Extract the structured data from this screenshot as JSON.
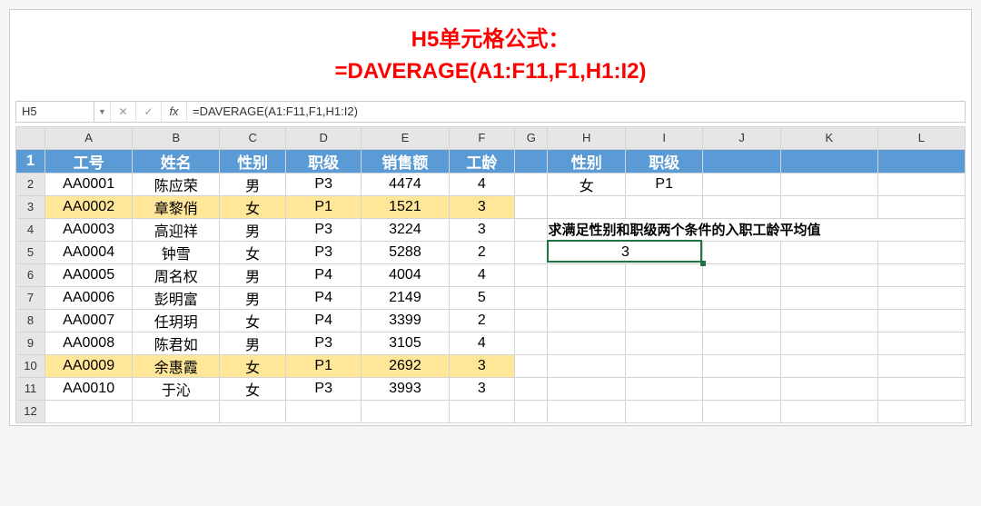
{
  "title": {
    "line1": "H5单元格公式：",
    "line2": "=DAVERAGE(A1:F11,F1,H1:I2)"
  },
  "formula_bar": {
    "cell_ref": "H5",
    "fx_label": "fx",
    "x": "✕",
    "check": "✓",
    "formula": "=DAVERAGE(A1:F11,F1,H1:I2)"
  },
  "columns": [
    "A",
    "B",
    "C",
    "D",
    "E",
    "F",
    "G",
    "H",
    "I",
    "J",
    "K",
    "L"
  ],
  "row_numbers": [
    "1",
    "2",
    "3",
    "4",
    "5",
    "6",
    "7",
    "8",
    "9",
    "10",
    "11",
    "12"
  ],
  "main_headers": [
    "工号",
    "姓名",
    "性别",
    "职级",
    "销售额",
    "工龄"
  ],
  "criteria_headers": [
    "性别",
    "职级"
  ],
  "criteria_values": [
    "女",
    "P1"
  ],
  "note": "求满足性别和职级两个条件的入职工龄平均值",
  "result": "3",
  "rows": [
    {
      "id": "AA0001",
      "name": "陈应荣",
      "gender": "男",
      "level": "P3",
      "sales": "4474",
      "years": "4",
      "hl": false
    },
    {
      "id": "AA0002",
      "name": "章黎俏",
      "gender": "女",
      "level": "P1",
      "sales": "1521",
      "years": "3",
      "hl": true
    },
    {
      "id": "AA0003",
      "name": "高迎祥",
      "gender": "男",
      "level": "P3",
      "sales": "3224",
      "years": "3",
      "hl": false
    },
    {
      "id": "AA0004",
      "name": "钟雪",
      "gender": "女",
      "level": "P3",
      "sales": "5288",
      "years": "2",
      "hl": false
    },
    {
      "id": "AA0005",
      "name": "周名权",
      "gender": "男",
      "level": "P4",
      "sales": "4004",
      "years": "4",
      "hl": false
    },
    {
      "id": "AA0006",
      "name": "彭明富",
      "gender": "男",
      "level": "P4",
      "sales": "2149",
      "years": "5",
      "hl": false
    },
    {
      "id": "AA0007",
      "name": "任玥玥",
      "gender": "女",
      "level": "P4",
      "sales": "3399",
      "years": "2",
      "hl": false
    },
    {
      "id": "AA0008",
      "name": "陈君如",
      "gender": "男",
      "level": "P3",
      "sales": "3105",
      "years": "4",
      "hl": false
    },
    {
      "id": "AA0009",
      "name": "余惠霞",
      "gender": "女",
      "level": "P1",
      "sales": "2692",
      "years": "3",
      "hl": true
    },
    {
      "id": "AA0010",
      "name": "于沁",
      "gender": "女",
      "level": "P3",
      "sales": "3993",
      "years": "3",
      "hl": false
    }
  ],
  "chart_data": {
    "type": "table",
    "title": "DAVERAGE 示例 — 求满足性别和职级两个条件的入职工龄平均值",
    "columns": [
      "工号",
      "姓名",
      "性别",
      "职级",
      "销售额",
      "工龄"
    ],
    "records": [
      [
        "AA0001",
        "陈应荣",
        "男",
        "P3",
        4474,
        4
      ],
      [
        "AA0002",
        "章黎俏",
        "女",
        "P1",
        1521,
        3
      ],
      [
        "AA0003",
        "高迎祥",
        "男",
        "P3",
        3224,
        3
      ],
      [
        "AA0004",
        "钟雪",
        "女",
        "P3",
        5288,
        2
      ],
      [
        "AA0005",
        "周名权",
        "男",
        "P4",
        4004,
        4
      ],
      [
        "AA0006",
        "彭明富",
        "男",
        "P4",
        2149,
        5
      ],
      [
        "AA0007",
        "任玥玥",
        "女",
        "P4",
        3399,
        2
      ],
      [
        "AA0008",
        "陈君如",
        "男",
        "P3",
        3105,
        4
      ],
      [
        "AA0009",
        "余惠霞",
        "女",
        "P1",
        2692,
        3
      ],
      [
        "AA0010",
        "于沁",
        "女",
        "P3",
        3993,
        3
      ]
    ],
    "criteria": {
      "性别": "女",
      "职级": "P1"
    },
    "formula": "=DAVERAGE(A1:F11,F1,H1:I2)",
    "result_field": "工龄",
    "result_value": 3
  }
}
